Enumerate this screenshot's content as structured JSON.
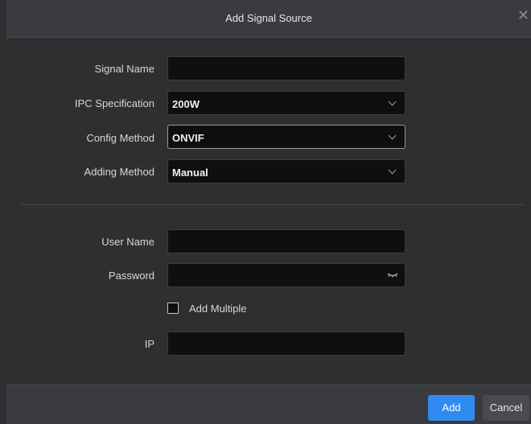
{
  "dialog": {
    "title": "Add Signal Source",
    "close_icon": "close-icon"
  },
  "form": {
    "signal_name": {
      "label": "Signal Name",
      "value": ""
    },
    "ipc_specification": {
      "label": "IPC Specification",
      "value": "200W"
    },
    "config_method": {
      "label": "Config Method",
      "value": "ONVIF"
    },
    "adding_method": {
      "label": "Adding Method",
      "value": "Manual"
    },
    "user_name": {
      "label": "User Name",
      "value": ""
    },
    "password": {
      "label": "Password",
      "value": "",
      "icon": "eye-closed-icon"
    },
    "add_multiple": {
      "label": "Add Multiple",
      "checked": false
    },
    "ip": {
      "label": "IP",
      "value": ""
    }
  },
  "footer": {
    "add_label": "Add",
    "cancel_label": "Cancel"
  },
  "colors": {
    "accent": "#2f8bf0",
    "background": "#2e2f31",
    "header": "#3a3b3e",
    "field": "#0f0f10"
  }
}
